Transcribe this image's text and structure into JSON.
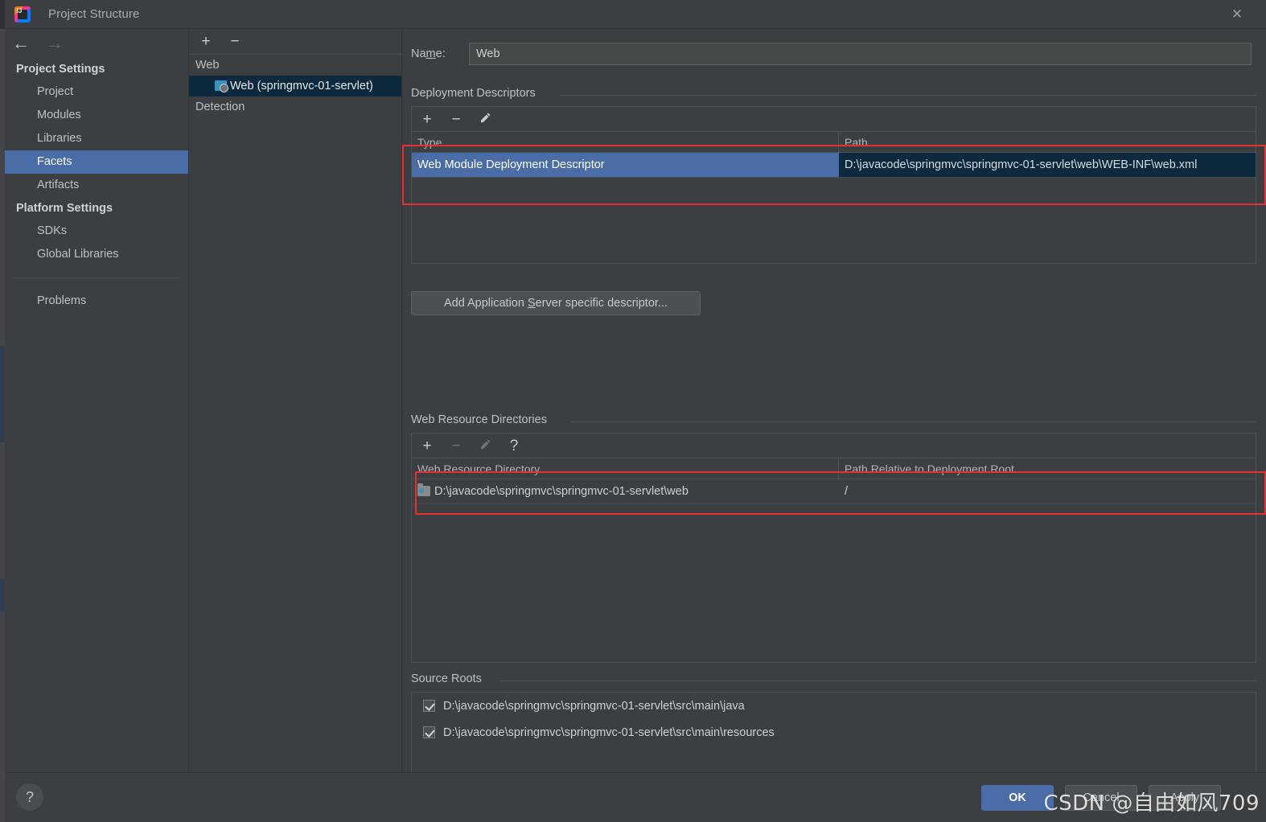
{
  "window": {
    "title": "Project Structure",
    "app_icon": "intellij-idea-icon",
    "close_icon": "✕"
  },
  "nav": {
    "back_icon": "←",
    "forward_icon": "→"
  },
  "sidebar": {
    "groups": [
      {
        "label": "Project Settings",
        "items": [
          {
            "label": "Project",
            "selected": false
          },
          {
            "label": "Modules",
            "selected": false
          },
          {
            "label": "Libraries",
            "selected": false
          },
          {
            "label": "Facets",
            "selected": true
          },
          {
            "label": "Artifacts",
            "selected": false
          }
        ]
      },
      {
        "label": "Platform Settings",
        "items": [
          {
            "label": "SDKs",
            "selected": false
          },
          {
            "label": "Global Libraries",
            "selected": false
          }
        ]
      }
    ],
    "extra_items": [
      {
        "label": "Problems",
        "selected": false
      }
    ]
  },
  "tree_panel": {
    "toolbar": {
      "add_icon": "+",
      "remove_icon": "−"
    },
    "rows": [
      {
        "label": "Web",
        "child": false,
        "selected": false,
        "icon": null
      },
      {
        "label": "Web (springmvc-01-servlet)",
        "child": true,
        "selected": true,
        "icon": "web-module-icon"
      },
      {
        "label": "Detection",
        "child": false,
        "selected": false,
        "icon": null
      }
    ]
  },
  "facet": {
    "name_label": "Name:",
    "name_mnemonic": "m",
    "name_value": "Web",
    "deployment_descriptors": {
      "title": "Deployment Descriptors",
      "toolbar": {
        "add_icon": "+",
        "remove_icon": "−",
        "edit_icon": "pencil-icon"
      },
      "columns": [
        "Type",
        "Path"
      ],
      "rows": [
        {
          "type": "Web Module Deployment Descriptor",
          "path": "D:\\javacode\\springmvc\\springmvc-01-servlet\\web\\WEB-INF\\web.xml"
        }
      ],
      "add_server_descriptor_button": {
        "prefix": "Add Application ",
        "mnemonic": "S",
        "suffix": "erver specific descriptor..."
      }
    },
    "web_resource_directories": {
      "title": "Web Resource Directories",
      "toolbar": {
        "add_icon": "+",
        "remove_icon": "−",
        "edit_icon": "pencil-icon",
        "help_icon": "?"
      },
      "columns": [
        "Web Resource Directory",
        "Path Relative to Deployment Root"
      ],
      "rows": [
        {
          "directory": "D:\\javacode\\springmvc\\springmvc-01-servlet\\web",
          "relative_path": "/"
        }
      ]
    },
    "source_roots": {
      "title": "Source Roots",
      "items": [
        {
          "path": "D:\\javacode\\springmvc\\springmvc-01-servlet\\src\\main\\java",
          "checked": true
        },
        {
          "path": "D:\\javacode\\springmvc\\springmvc-01-servlet\\src\\main\\resources",
          "checked": true
        }
      ]
    }
  },
  "footer": {
    "help_icon": "?",
    "ok_label": "OK",
    "cancel_label": "Cancel",
    "apply_label": "Apply"
  },
  "watermark": {
    "text": "CSDN @自由如风709"
  },
  "colors": {
    "accent_selection": "#4a6da7",
    "unfocused_selection": "#0d293e",
    "panel_bg": "#3c3f41",
    "annotation_red": "#e83030"
  }
}
